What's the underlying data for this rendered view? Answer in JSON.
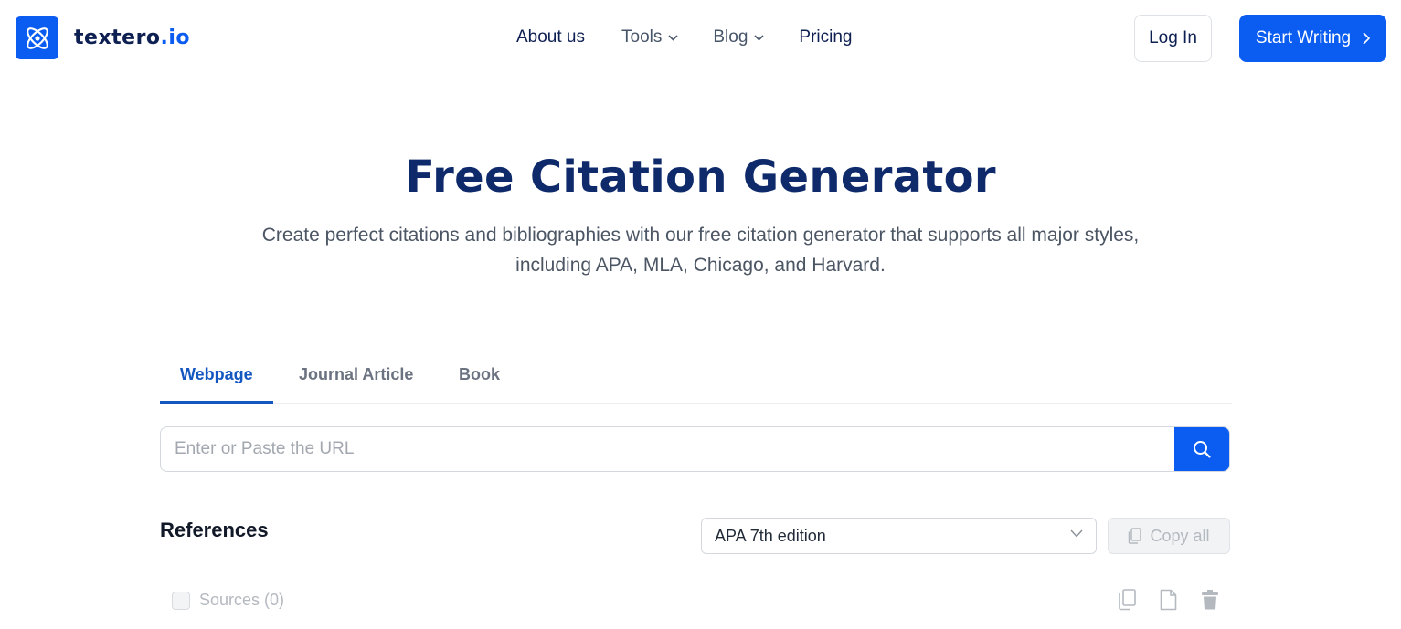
{
  "brand": {
    "name_main": "textero",
    "name_suffix": ".io",
    "accent_color": "#0b5cf0",
    "logo_icon": "atom-icon"
  },
  "nav": {
    "items": [
      {
        "label": "About us",
        "has_dropdown": false
      },
      {
        "label": "Tools",
        "has_dropdown": true
      },
      {
        "label": "Blog",
        "has_dropdown": true
      },
      {
        "label": "Pricing",
        "has_dropdown": false
      }
    ],
    "login_label": "Log In",
    "start_label": "Start Writing"
  },
  "hero": {
    "title": "Free Citation Generator",
    "subtitle_line1": "Create perfect citations and bibliographies with our free citation generator that supports all major styles,",
    "subtitle_line2": "including APA, MLA, Chicago, and Harvard."
  },
  "tabs": {
    "items": [
      {
        "label": "Webpage",
        "active": true
      },
      {
        "label": "Journal Article",
        "active": false
      },
      {
        "label": "Book",
        "active": false
      }
    ]
  },
  "search": {
    "placeholder": "Enter or Paste the URL",
    "value": "",
    "button_icon": "search-icon"
  },
  "references": {
    "title": "References",
    "style_selected": "APA 7th edition",
    "copy_all_label": "Copy all",
    "sources_label": "Sources (0)",
    "row_icons": [
      "copy-icon",
      "document-icon",
      "trash-icon"
    ]
  }
}
